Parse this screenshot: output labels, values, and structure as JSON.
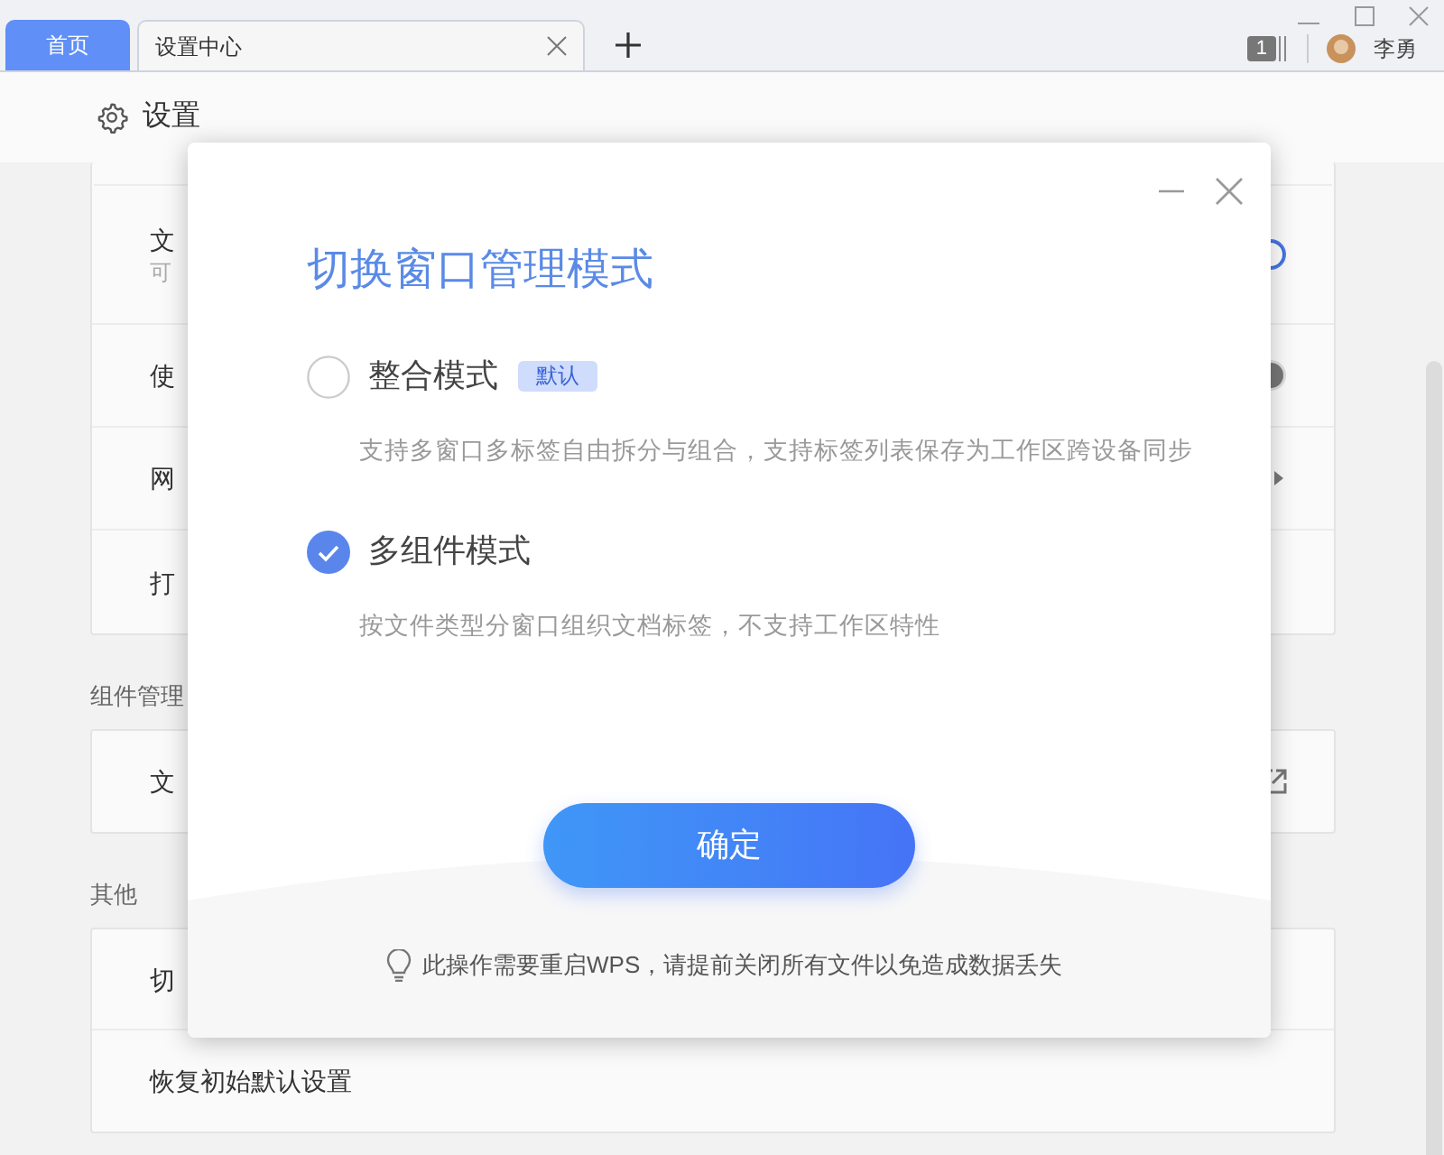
{
  "tabs": [
    {
      "kind": "home",
      "label": "首页",
      "selected": false
    },
    {
      "kind": "document",
      "label": "设置中心",
      "selected": true
    }
  ],
  "titlebar": {
    "badge": "1",
    "user": "李勇"
  },
  "header": {
    "title": "设置"
  },
  "sections": [
    {
      "rows": [
        {
          "title": "文",
          "subtitle": "可",
          "kind": "toggle",
          "on": true
        },
        {
          "title": "使",
          "kind": "toggle",
          "on": false
        },
        {
          "title": "网",
          "kind": "arrow"
        },
        {
          "title": "打"
        }
      ]
    },
    {
      "label": "组件管理",
      "rows": [
        {
          "title": "文",
          "kind": "external"
        }
      ]
    },
    {
      "label": "其他",
      "rows": [
        {
          "title": "切"
        },
        {
          "title": "恢复初始默认设置"
        }
      ]
    }
  ],
  "dialog": {
    "title": "切换窗口管理模式",
    "options": [
      {
        "label": "整合模式",
        "badge": "默认",
        "description": "支持多窗口多标签自由拆分与组合，支持标签列表保存为工作区跨设备同步",
        "selected": false
      },
      {
        "label": "多组件模式",
        "description": "按文件类型分窗口组织文档标签，不支持工作区特性",
        "selected": true
      }
    ],
    "button": "确定",
    "note": "此操作需要重启WPS，请提前关闭所有文件以免造成数据丢失"
  }
}
